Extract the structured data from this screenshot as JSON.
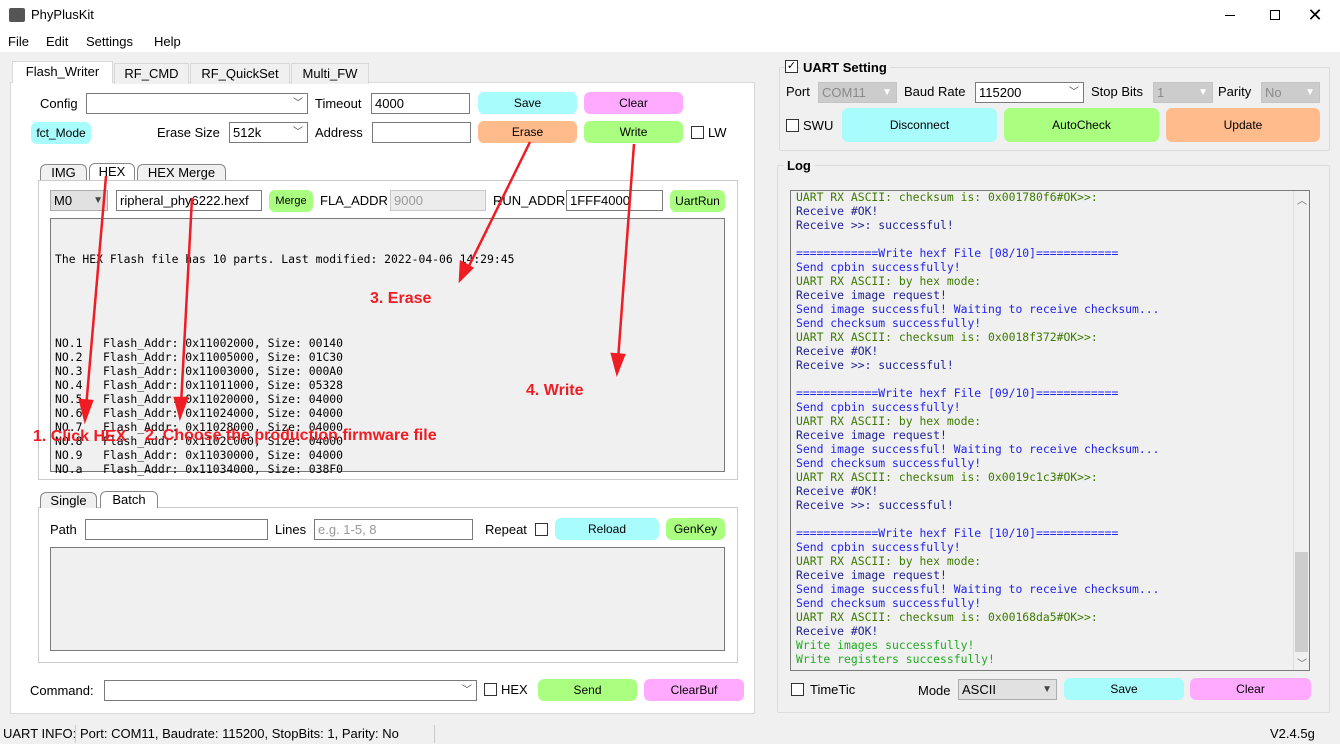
{
  "window": {
    "title": "PhyPlusKit",
    "icon": "app-icon",
    "controls": [
      "minimize-icon",
      "maximize-icon",
      "close-icon"
    ]
  },
  "menu": [
    "File",
    "Edit",
    "Settings",
    "Help"
  ],
  "tabs": [
    "Flash_Writer",
    "RF_CMD",
    "RF_QuickSet",
    "Multi_FW"
  ],
  "flash": {
    "config_label": "Config",
    "config_value": "",
    "timeout_label": "Timeout",
    "timeout_value": "4000",
    "save": "Save",
    "clear": "Clear",
    "fct_mode": "fct_Mode",
    "erase_size_label": "Erase Size",
    "erase_size_value": "512k",
    "address_label": "Address",
    "address_value": "",
    "erase": "Erase",
    "write": "Write",
    "lw_label": "LW",
    "lw_checked": false
  },
  "inner_tabs": [
    "IMG",
    "HEX",
    "HEX Merge"
  ],
  "hex": {
    "mode_value": "M0",
    "file_value": "ripheral_phy6222.hexf",
    "merge": "Merge",
    "fla_addr_label": "FLA_ADDR",
    "fla_addr_value": "9000",
    "run_addr_label": "RUN_ADDR",
    "run_addr_value": "1FFF4000",
    "uartrun": "UartRun",
    "info": "The HEX Flash file has 10 parts. Last modified: 2022-04-06 14:29:45",
    "parts": [
      [
        "NO.1",
        "0x11002000",
        "00140"
      ],
      [
        "NO.2",
        "0x11005000",
        "01C30"
      ],
      [
        "NO.3",
        "0x11003000",
        "000A0"
      ],
      [
        "NO.4",
        "0x11011000",
        "05328"
      ],
      [
        "NO.5",
        "0x11020000",
        "04000"
      ],
      [
        "NO.6",
        "0x11024000",
        "04000"
      ],
      [
        "NO.7",
        "0x11028000",
        "04000"
      ],
      [
        "NO.8",
        "0x1102C000",
        "04000"
      ],
      [
        "NO.9",
        "0x11030000",
        "04000"
      ],
      [
        "NO.a",
        "0x11034000",
        "038F0"
      ]
    ]
  },
  "annotations": {
    "a1": "1. Click HEX",
    "a2": "2. Choose the production firmware file",
    "a3": "3. Erase",
    "a4": "4. Write",
    "color": "#f01c24"
  },
  "batch_tabs": [
    "Single",
    "Batch"
  ],
  "batch": {
    "path_label": "Path",
    "path_value": "",
    "lines_label": "Lines",
    "lines_placeholder": "e.g. 1-5, 8",
    "repeat_label": "Repeat",
    "reload": "Reload",
    "genkey": "GenKey"
  },
  "command": {
    "label": "Command:",
    "value": "",
    "hex_label": "HEX",
    "send": "Send",
    "clearbuf": "ClearBuf"
  },
  "status": {
    "label": "UART INFO:",
    "info": "Port: COM11, Baudrate: 115200, StopBits: 1, Parity: No",
    "version": "V2.4.5g"
  },
  "uart": {
    "title": "UART Setting",
    "enabled": true,
    "port_label": "Port",
    "port_value": "COM11",
    "baud_label": "Baud Rate",
    "baud_value": "115200",
    "stop_label": "Stop Bits",
    "stop_value": "1",
    "parity_label": "Parity",
    "parity_value": "No",
    "swu_label": "SWU",
    "disconnect": "Disconnect",
    "autocheck": "AutoCheck",
    "update": "Update"
  },
  "log": {
    "title": "Log",
    "lines": [
      [
        "UART RX ASCII: checksum is: 0x001780f6#OK>>:",
        "green"
      ],
      [
        "Receive #OK!",
        "navy"
      ],
      [
        "Receive >>: successful!",
        "navy"
      ],
      [
        "",
        ""
      ],
      [
        "============Write hexf File [08/10]============",
        "blue"
      ],
      [
        "Send cpbin successfully!",
        "blue"
      ],
      [
        "UART RX ASCII: by hex mode:",
        "green"
      ],
      [
        "Receive image request!",
        "navy"
      ],
      [
        "Send image successful! Waiting to receive checksum...",
        "blue"
      ],
      [
        "Send checksum successfully!",
        "blue"
      ],
      [
        "UART RX ASCII: checksum is: 0x0018f372#OK>>:",
        "green"
      ],
      [
        "Receive #OK!",
        "navy"
      ],
      [
        "Receive >>: successful!",
        "navy"
      ],
      [
        "",
        ""
      ],
      [
        "============Write hexf File [09/10]============",
        "blue"
      ],
      [
        "Send cpbin successfully!",
        "blue"
      ],
      [
        "UART RX ASCII: by hex mode:",
        "green"
      ],
      [
        "Receive image request!",
        "navy"
      ],
      [
        "Send image successful! Waiting to receive checksum...",
        "blue"
      ],
      [
        "Send checksum successfully!",
        "blue"
      ],
      [
        "UART RX ASCII: checksum is: 0x0019c1c3#OK>>:",
        "green"
      ],
      [
        "Receive #OK!",
        "navy"
      ],
      [
        "Receive >>: successful!",
        "navy"
      ],
      [
        "",
        ""
      ],
      [
        "============Write hexf File [10/10]============",
        "blue"
      ],
      [
        "Send cpbin successfully!",
        "blue"
      ],
      [
        "UART RX ASCII: by hex mode:",
        "green"
      ],
      [
        "Receive image request!",
        "navy"
      ],
      [
        "Send image successful! Waiting to receive checksum...",
        "blue"
      ],
      [
        "Send checksum successfully!",
        "blue"
      ],
      [
        "UART RX ASCII: checksum is: 0x00168da5#OK>>:",
        "green"
      ],
      [
        "Receive #OK!",
        "navy"
      ],
      [
        "Write images successfully!",
        "bright"
      ],
      [
        "Write registers successfully!",
        "bright"
      ]
    ],
    "timetic_label": "TimeTic",
    "mode_label": "Mode",
    "mode_value": "ASCII",
    "save": "Save",
    "clear": "Clear"
  }
}
